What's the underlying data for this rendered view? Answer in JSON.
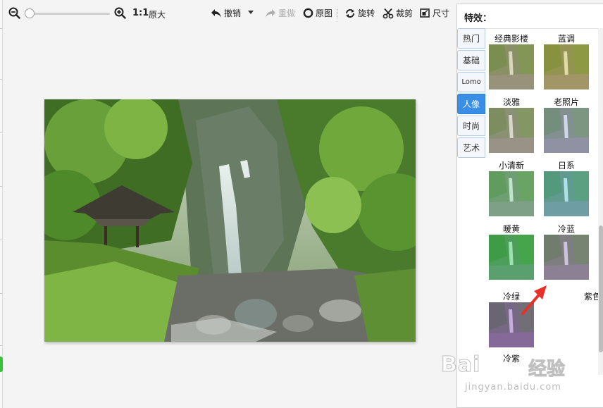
{
  "toolbar": {
    "ratio": "1:1",
    "ratio_label": "原大",
    "undo_label": "撤销",
    "redo_label": "重做",
    "original_label": "原图",
    "rotate_label": "旋转",
    "crop_label": "裁剪",
    "size_label": "尺寸",
    "zoom_level": 0.03
  },
  "panel": {
    "title": "特效：",
    "tabs": [
      {
        "label": "热门",
        "active": false
      },
      {
        "label": "基础",
        "active": false
      },
      {
        "label": "Lomo",
        "active": false
      },
      {
        "label": "人像",
        "active": true
      },
      {
        "label": "时尚",
        "active": false
      },
      {
        "label": "艺术",
        "active": false
      }
    ],
    "effects": [
      {
        "label": "经典影楼",
        "tint": "#c8b98a"
      },
      {
        "label": "蓝调",
        "tint": "#e0c060"
      },
      {
        "label": "淡雅",
        "tint": "#c9b8a8"
      },
      {
        "label": "老照片",
        "tint": "#b8b8e8"
      },
      {
        "label": "小清新",
        "tint": "#8fd8a8"
      },
      {
        "label": "日系",
        "tint": "#6fd0e8"
      },
      {
        "label": "暖黄",
        "tint": "#40d870"
      },
      {
        "label": "冷蓝",
        "tint": "#b090c8"
      },
      {
        "label": "冷绿",
        "tint": "#a060d0"
      },
      {
        "label": "紫色幻想",
        "tint": ""
      },
      {
        "label": "冷紫",
        "tint": ""
      }
    ]
  },
  "watermark": {
    "brand": "Bai",
    "brand_cn": "经验",
    "url": "jingyan.baidu.com"
  },
  "colors": {
    "accent": "#3b8ee6",
    "arrow": "#e8302a"
  }
}
